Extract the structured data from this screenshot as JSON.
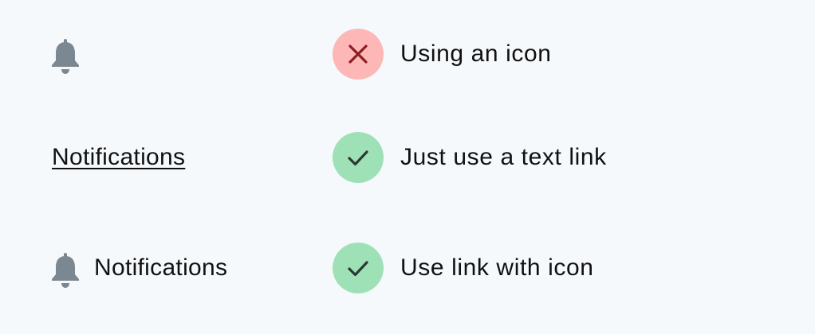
{
  "colors": {
    "background": "#f6f9fc",
    "icon_gray": "#7b8791",
    "bad_badge": "#fdb7b7",
    "bad_mark": "#8b1e1e",
    "good_badge": "#9ee1b7",
    "good_mark": "#2a3a33"
  },
  "rows": [
    {
      "example": {
        "type": "icon-only",
        "icon": "bell-icon"
      },
      "verdict": {
        "status": "bad",
        "icon": "x-icon",
        "caption": "Using an icon"
      }
    },
    {
      "example": {
        "type": "text-link",
        "label": "Notifications"
      },
      "verdict": {
        "status": "good",
        "icon": "check-icon",
        "caption": "Just use a text link"
      }
    },
    {
      "example": {
        "type": "icon-with-text",
        "icon": "bell-icon",
        "label": "Notifications"
      },
      "verdict": {
        "status": "good",
        "icon": "check-icon",
        "caption": "Use link with icon"
      }
    }
  ]
}
